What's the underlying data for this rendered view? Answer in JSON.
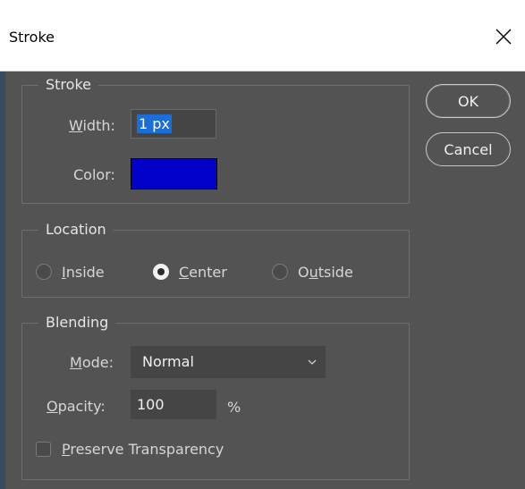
{
  "window": {
    "title": "Stroke"
  },
  "stroke_group": {
    "legend": "Stroke",
    "width_label_mnemonic": "W",
    "width_label_rest": "idth:",
    "width_value": "1 px",
    "color_label": "Color:",
    "color_value": "#0000c8"
  },
  "buttons": {
    "ok": "OK",
    "cancel": "Cancel"
  },
  "location_group": {
    "legend": "Location",
    "options": [
      {
        "mnemonic": "I",
        "rest": "nside",
        "checked": false
      },
      {
        "mnemonic": "C",
        "rest": "enter",
        "checked": true
      },
      {
        "pre": "O",
        "mnemonic": "u",
        "rest": "tside",
        "checked": false
      }
    ]
  },
  "blending_group": {
    "legend": "Blending",
    "mode_label_mnemonic": "M",
    "mode_label_rest": "ode:",
    "mode_value": "Normal",
    "opacity_label_mnemonic": "O",
    "opacity_label_rest": "pacity:",
    "opacity_value": "100",
    "opacity_unit": "%",
    "preserve_mnemonic": "P",
    "preserve_rest": "reserve Transparency",
    "preserve_checked": false
  },
  "icons": {
    "close": "close-icon",
    "dropdown": "chevron-down-icon"
  }
}
